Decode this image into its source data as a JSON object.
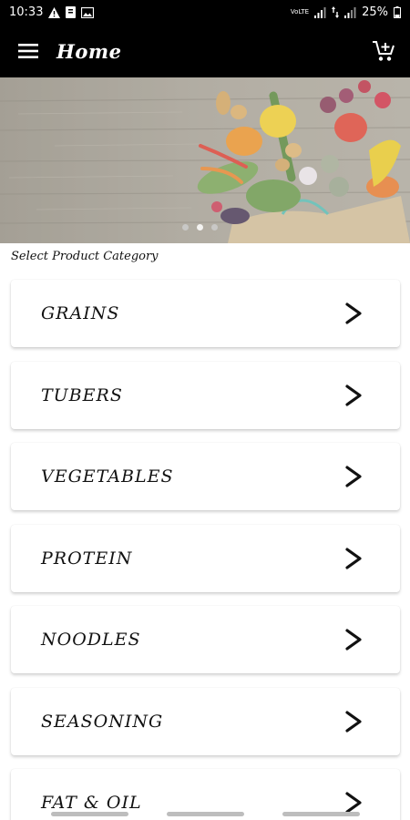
{
  "status_bar": {
    "time": "10:33",
    "network_label": "VoLTE",
    "battery": "25%"
  },
  "app_bar": {
    "title": "Home"
  },
  "banner": {
    "slide_count": 3,
    "active_slide": 2
  },
  "content": {
    "section_label": "Select Product Category",
    "categories": [
      {
        "label": "GRAINS"
      },
      {
        "label": "TUBERS"
      },
      {
        "label": "VEGETABLES"
      },
      {
        "label": "PROTEIN"
      },
      {
        "label": "NOODLES"
      },
      {
        "label": "SEASONING"
      },
      {
        "label": "FAT & OIL"
      }
    ]
  },
  "icons": {
    "menu": "hamburger-icon",
    "cart": "cart-add-icon",
    "chevron": "chevron-right-icon"
  },
  "colors": {
    "app_bar": "#000000",
    "background": "#ffffff",
    "card": "#ffffff"
  }
}
